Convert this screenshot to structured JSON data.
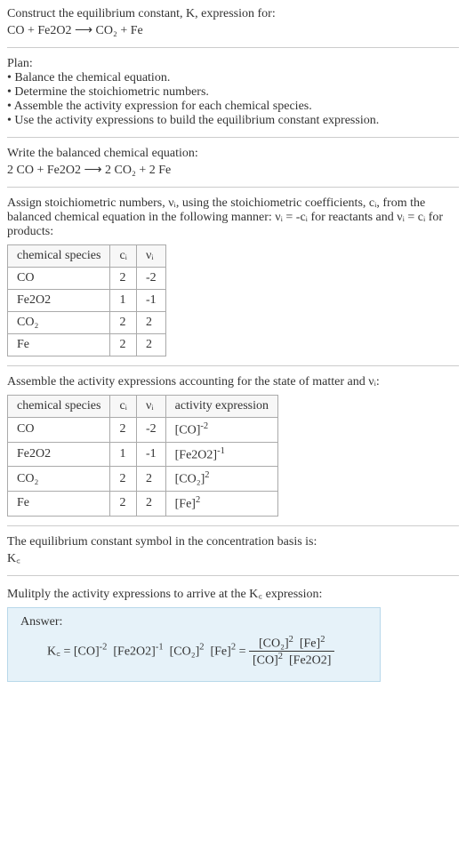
{
  "intro": {
    "line1": "Construct the equilibrium constant, K, expression for:",
    "eq_unbalanced": "CO + Fe2O2 ⟶ CO₂ + Fe"
  },
  "plan": {
    "heading": "Plan:",
    "b1": "• Balance the chemical equation.",
    "b2": "• Determine the stoichiometric numbers.",
    "b3": "• Assemble the activity expression for each chemical species.",
    "b4": "• Use the activity expressions to build the equilibrium constant expression."
  },
  "balanced": {
    "heading": "Write the balanced chemical equation:",
    "eq": "2 CO + Fe2O2 ⟶ 2 CO₂ + 2 Fe"
  },
  "stoich": {
    "text": "Assign stoichiometric numbers, νᵢ, using the stoichiometric coefficients, cᵢ, from the balanced chemical equation in the following manner: νᵢ = -cᵢ for reactants and νᵢ = cᵢ for products:",
    "headers": {
      "h1": "chemical species",
      "h2": "cᵢ",
      "h3": "νᵢ"
    },
    "rows": [
      {
        "sp": "CO",
        "c": "2",
        "v": "-2"
      },
      {
        "sp": "Fe2O2",
        "c": "1",
        "v": "-1"
      },
      {
        "sp": "CO₂",
        "c": "2",
        "v": "2"
      },
      {
        "sp": "Fe",
        "c": "2",
        "v": "2"
      }
    ]
  },
  "activity": {
    "text": "Assemble the activity expressions accounting for the state of matter and νᵢ:",
    "headers": {
      "h1": "chemical species",
      "h2": "cᵢ",
      "h3": "νᵢ",
      "h4": "activity expression"
    },
    "rows": [
      {
        "sp": "CO",
        "c": "2",
        "v": "-2",
        "exprBase": "[CO]",
        "exprSup": "-2"
      },
      {
        "sp": "Fe2O2",
        "c": "1",
        "v": "-1",
        "exprBase": "[Fe2O2]",
        "exprSup": "-1"
      },
      {
        "sp": "CO₂",
        "c": "2",
        "v": "2",
        "exprBase": "[CO₂]",
        "exprSup": "2"
      },
      {
        "sp": "Fe",
        "c": "2",
        "v": "2",
        "exprBase": "[Fe]",
        "exprSup": "2"
      }
    ]
  },
  "symbol": {
    "text": "The equilibrium constant symbol in the concentration basis is:",
    "sym": "K꜀"
  },
  "final": {
    "text": "Mulitply the activity expressions to arrive at the K꜀ expression:",
    "answerLabel": "Answer:",
    "lhs": "K꜀ = ",
    "t1b": "[CO]",
    "t1s": "-2",
    "t2b": "[Fe2O2]",
    "t2s": "-1",
    "t3b": "[CO₂]",
    "t3s": "2",
    "t4b": "[Fe]",
    "t4s": "2",
    "eq": " = ",
    "num1b": "[CO₂]",
    "num1s": "2",
    "num2b": "[Fe]",
    "num2s": "2",
    "den1b": "[CO]",
    "den1s": "2",
    "den2b": "[Fe2O2]"
  }
}
